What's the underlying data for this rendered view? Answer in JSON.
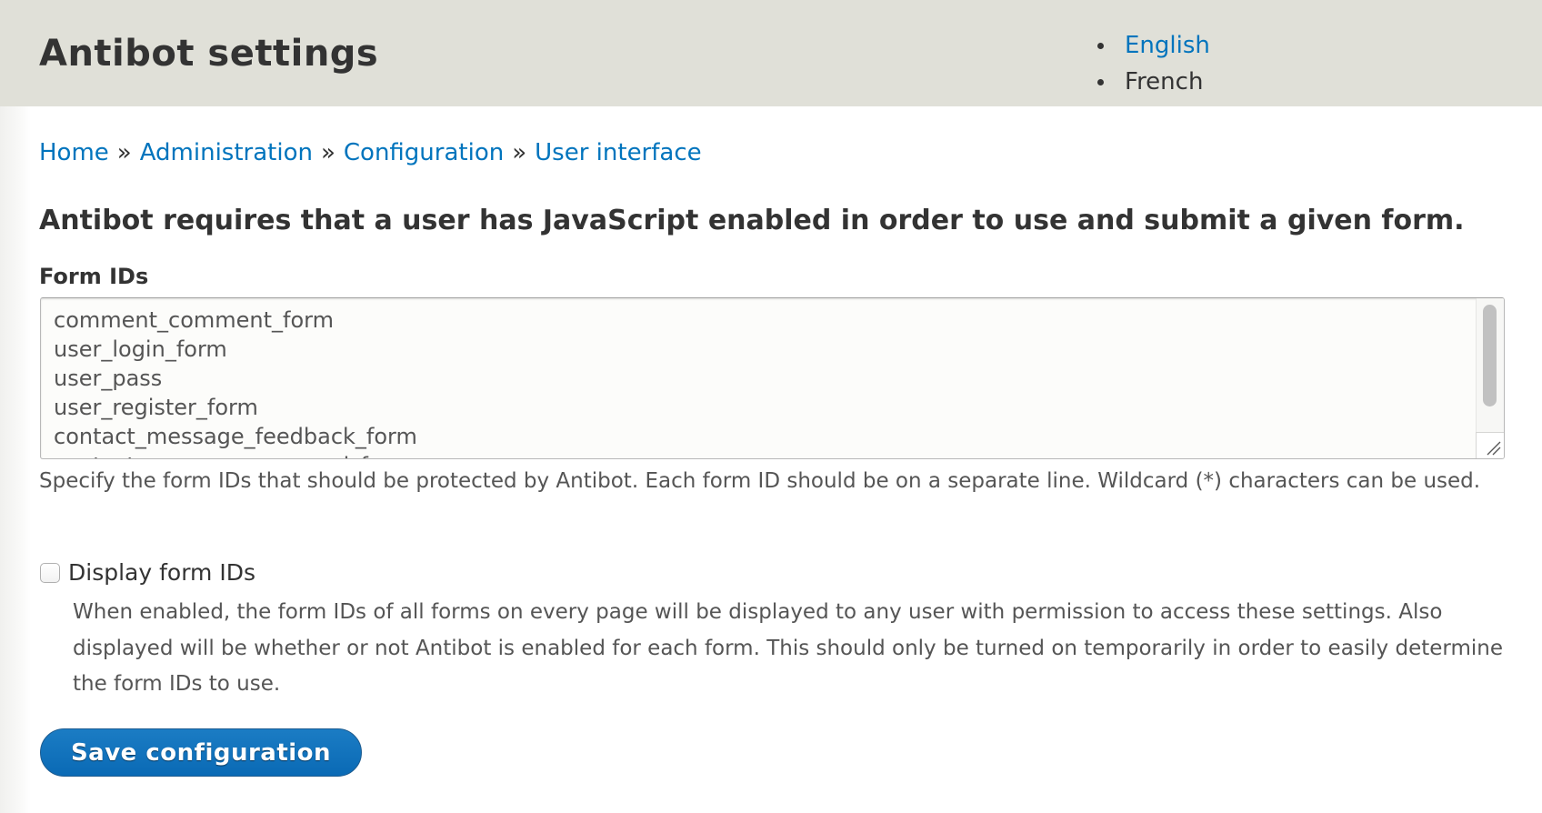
{
  "header": {
    "title": "Antibot settings",
    "languages": [
      {
        "label": "English",
        "active_link": true
      },
      {
        "label": "French",
        "active_link": false
      }
    ]
  },
  "breadcrumb": {
    "items": [
      "Home",
      "Administration",
      "Configuration",
      "User interface"
    ],
    "separator": "»"
  },
  "intro": "Antibot requires that a user has JavaScript enabled in order to use and submit a given form.",
  "form_ids": {
    "label": "Form IDs",
    "value": "comment_comment_form\nuser_login_form\nuser_pass\nuser_register_form\ncontact_message_feedback_form\ncontact_message_personal_form",
    "description": "Specify the form IDs that should be protected by Antibot. Each form ID should be on a separate line. Wildcard (*) characters can be used."
  },
  "display_form_ids": {
    "label": "Display form IDs",
    "checked": false,
    "description": "When enabled, the form IDs of all forms on every page will be displayed to any user with permission to access these settings. Also displayed will be whether or not Antibot is enabled for each form. This should only be turned on temporarily in order to easily determine the form IDs to use."
  },
  "actions": {
    "save_label": "Save configuration"
  },
  "colors": {
    "header_bg": "#e0e0d8",
    "link": "#0074bd",
    "primary_button": "#0a6ab5",
    "text": "#333333",
    "muted_text": "#555555"
  }
}
